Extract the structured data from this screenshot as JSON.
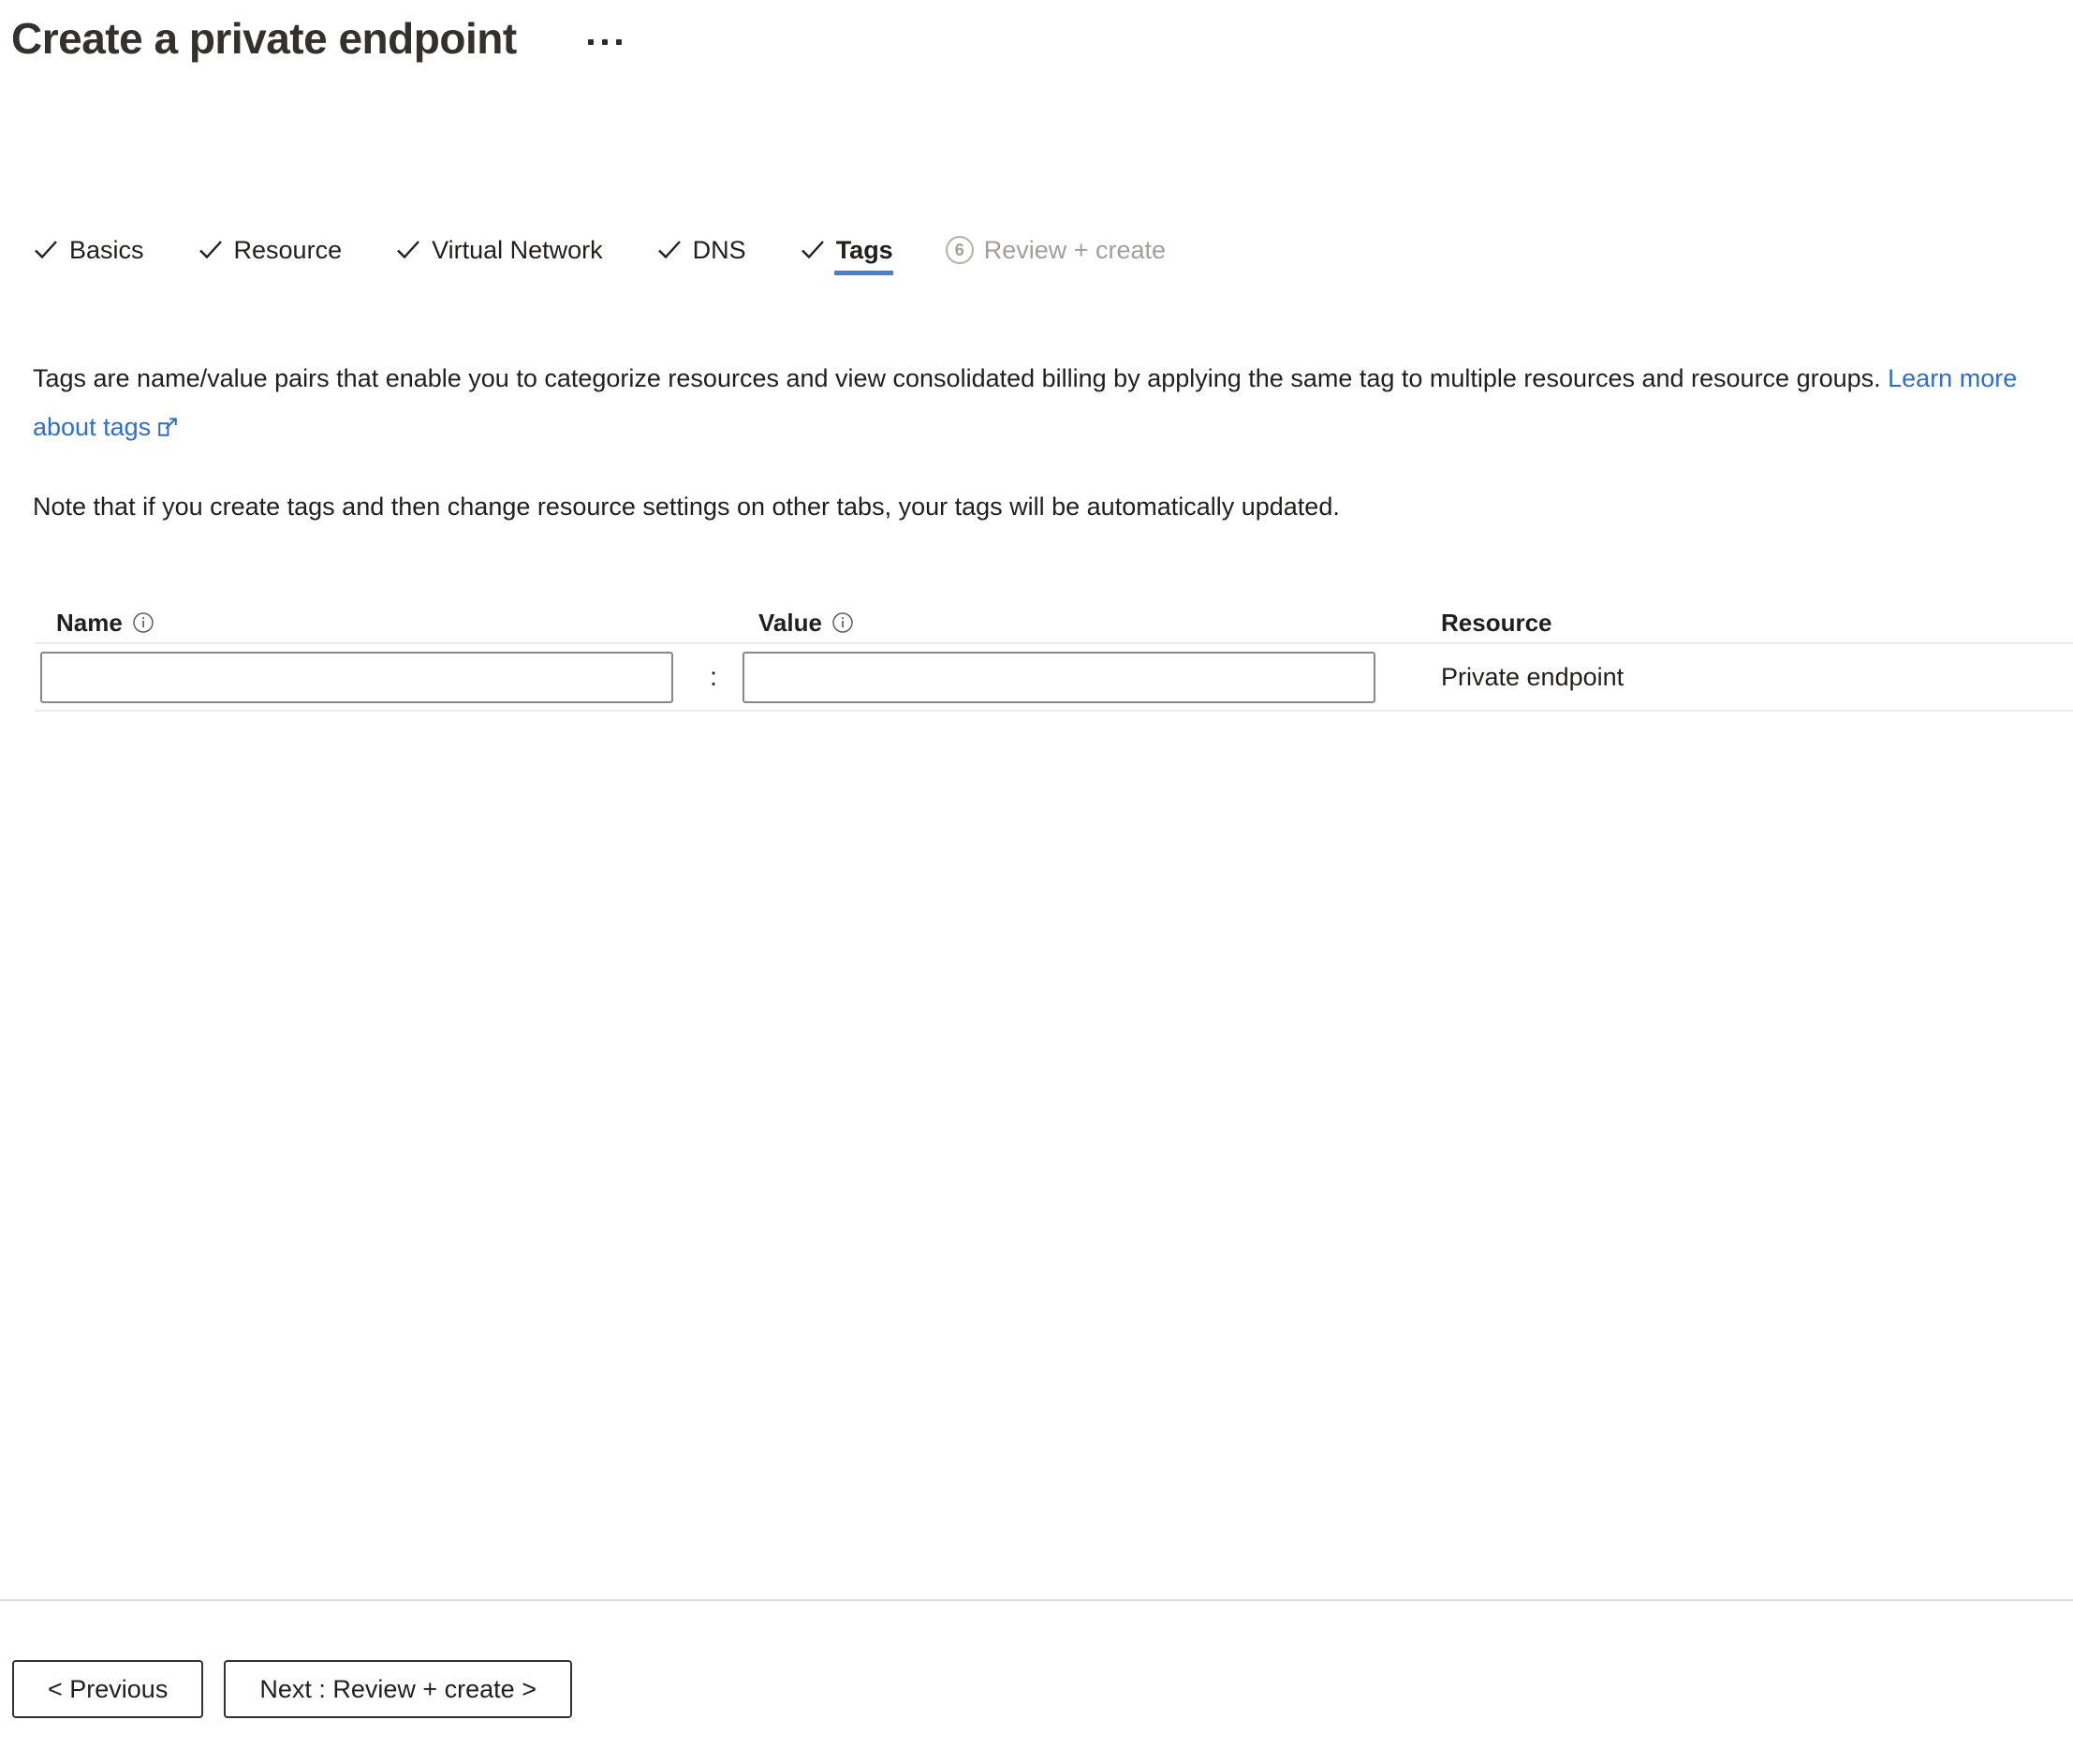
{
  "header": {
    "title": "Create a private endpoint",
    "more_menu_label": "..."
  },
  "tabs": [
    {
      "label": "Basics",
      "state": "completed",
      "icon": "check-icon"
    },
    {
      "label": "Resource",
      "state": "completed",
      "icon": "check-icon"
    },
    {
      "label": "Virtual Network",
      "state": "completed",
      "icon": "check-icon"
    },
    {
      "label": "DNS",
      "state": "completed",
      "icon": "check-icon"
    },
    {
      "label": "Tags",
      "state": "active",
      "icon": "check-icon"
    },
    {
      "label": "Review + create",
      "state": "disabled",
      "step": "6"
    }
  ],
  "content": {
    "description_part1": "Tags are name/value pairs that enable you to categorize resources and view consolidated billing by applying the same tag to multiple resources and resource groups. ",
    "learn_more_link": "Learn more about tags",
    "note": "Note that if you create tags and then change resource settings on other tabs, your tags will be automatically updated."
  },
  "tag_table": {
    "headers": {
      "name": "Name",
      "value": "Value",
      "resource": "Resource"
    },
    "separator": ":",
    "rows": [
      {
        "name_value": "",
        "name_placeholder": "",
        "value_value": "",
        "value_placeholder": "",
        "resource": "Private endpoint"
      }
    ]
  },
  "footer": {
    "previous_label": "< Previous",
    "next_label": "Next : Review + create >"
  },
  "colors": {
    "accent": "#4a7ed0",
    "link": "#2f6fca",
    "text": "#201f1e",
    "disabled_text": "#a19f9d",
    "border": "#8a8886",
    "divider": "#edebe9"
  }
}
